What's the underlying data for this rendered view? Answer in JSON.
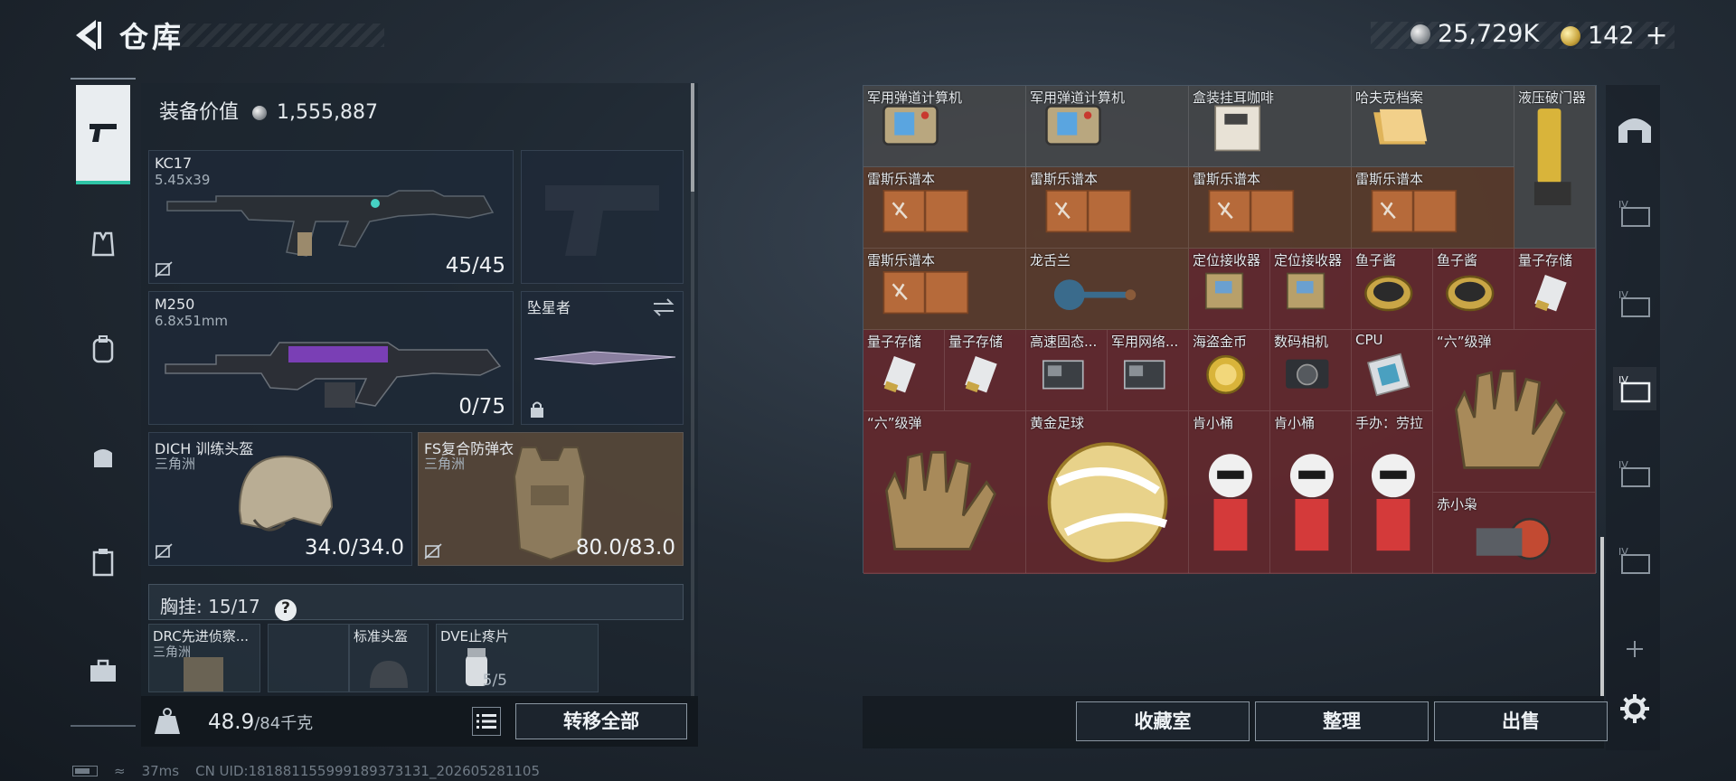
{
  "header": {
    "title": "仓库",
    "silver": "25,729K",
    "gold": "142",
    "plus": "+"
  },
  "equipment": {
    "value_label": "装备价值",
    "value": "1,555,887",
    "primary": {
      "name": "KC17",
      "caliber": "5.45x39",
      "ammo": "45/45"
    },
    "secondary": {
      "name": "M250",
      "caliber": "6.8x51mm",
      "ammo": "0/75"
    },
    "melee": {
      "name": "坠星者"
    },
    "helmet": {
      "name": "DICH 训练头盔",
      "maker": "三角洲",
      "durability": "34.0/34.0"
    },
    "armor": {
      "name": "FS复合防弹衣",
      "maker": "三角洲",
      "durability": "80.0/83.0"
    },
    "rig": {
      "label": "胸挂:",
      "capacity": "15/17",
      "help": "?",
      "items": [
        {
          "name": "DRC先进侦察...",
          "maker": "三角洲",
          "count": ""
        },
        {
          "name": "标准头盔",
          "maker": "",
          "count": ""
        },
        {
          "name": "DVE止疼片",
          "maker": "",
          "count": "5/5"
        }
      ]
    },
    "weight": "48.9",
    "weight_cap": "/84千克",
    "transfer_all": "转移全部"
  },
  "storage": {
    "items": [
      {
        "name": "军用弹道计算机",
        "rarity": "gray"
      },
      {
        "name": "军用弹道计算机",
        "rarity": "gray"
      },
      {
        "name": "盒装挂耳咖啡",
        "rarity": "gray"
      },
      {
        "name": "哈夫克档案",
        "rarity": "gray"
      },
      {
        "name": "液压破门器",
        "rarity": "gray"
      },
      {
        "name": "雷斯乐谱本",
        "rarity": "brown"
      },
      {
        "name": "雷斯乐谱本",
        "rarity": "brown"
      },
      {
        "name": "雷斯乐谱本",
        "rarity": "brown"
      },
      {
        "name": "雷斯乐谱本",
        "rarity": "brown"
      },
      {
        "name": "雷斯乐谱本",
        "rarity": "brown"
      },
      {
        "name": "龙舌兰",
        "rarity": "brown"
      },
      {
        "name": "定位接收器",
        "rarity": "red"
      },
      {
        "name": "定位接收器",
        "rarity": "red"
      },
      {
        "name": "鱼子酱",
        "rarity": "red"
      },
      {
        "name": "鱼子酱",
        "rarity": "red"
      },
      {
        "name": "量子存储",
        "rarity": "red"
      },
      {
        "name": "量子存储",
        "rarity": "red"
      },
      {
        "name": "量子存储",
        "rarity": "red"
      },
      {
        "name": "高速固态...",
        "rarity": "red"
      },
      {
        "name": "军用网络...",
        "rarity": "red"
      },
      {
        "name": "海盗金币",
        "rarity": "red"
      },
      {
        "name": "数码相机",
        "rarity": "red"
      },
      {
        "name": "CPU",
        "rarity": "red"
      },
      {
        "name": "“六”级弹",
        "rarity": "red"
      },
      {
        "name": "“六”级弹",
        "rarity": "red"
      },
      {
        "name": "黄金足球",
        "rarity": "red"
      },
      {
        "name": "肯小桶",
        "rarity": "red"
      },
      {
        "name": "肯小桶",
        "rarity": "red"
      },
      {
        "name": "手办：劳拉",
        "rarity": "red"
      },
      {
        "name": "赤小枭",
        "rarity": "red"
      }
    ]
  },
  "bottom_buttons": {
    "collection": "收藏室",
    "sort": "整理",
    "sell": "出售"
  },
  "status": {
    "ping": "37ms",
    "uid": "CN UID:181881155999189373131_202605281105"
  },
  "colors": {
    "accent": "#2fc4a6",
    "gray": "#464a4e",
    "brown": "#5e3c2a",
    "red": "#6e282c"
  }
}
